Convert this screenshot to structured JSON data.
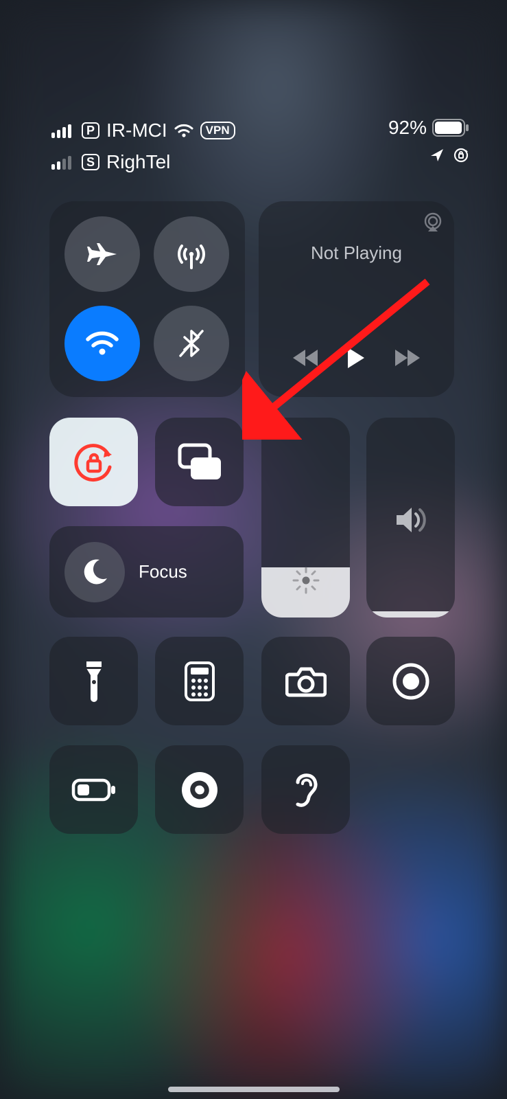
{
  "status": {
    "carrier1": {
      "name": "IR-MCI",
      "bars": 4,
      "type_badge": "P",
      "wifi": true,
      "vpn_label": "VPN"
    },
    "carrier2": {
      "name": "RighTel",
      "bars": 2,
      "type_badge": "S"
    },
    "battery_percent": "92%",
    "indicators": {
      "location": true,
      "rotation_lock": true
    }
  },
  "connectivity": {
    "airplane_on": false,
    "cellular_on": false,
    "wifi_on": true,
    "bluetooth_on": false
  },
  "media": {
    "now_playing_label": "Not Playing"
  },
  "tiles": {
    "orientation_lock_on": true,
    "focus_label": "Focus"
  },
  "sliders": {
    "brightness_pct": 25,
    "volume_pct": 3
  },
  "extras": {
    "flashlight": "flashlight",
    "calculator": "calculator",
    "camera": "camera",
    "screen_record": "screen-record",
    "low_power": "low-power-mode",
    "shazam": "shazam",
    "hearing": "hearing"
  },
  "annotation": {
    "arrow_target": "screen-mirroring"
  }
}
